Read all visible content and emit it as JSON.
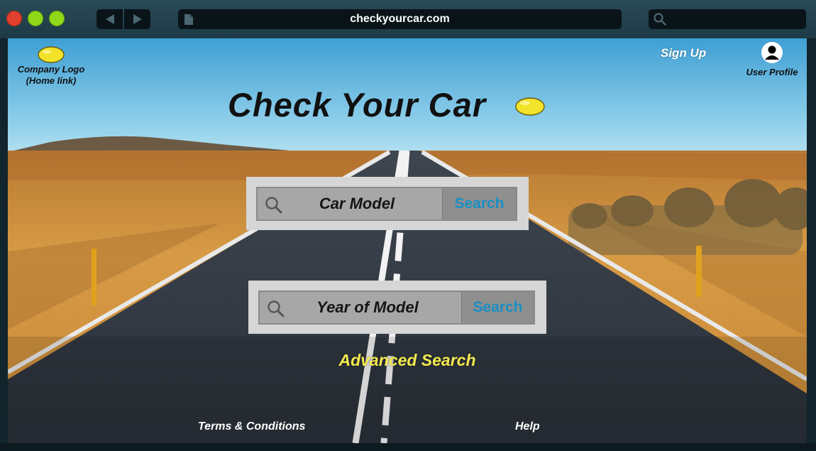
{
  "browser": {
    "url": "checkyourcar.com",
    "window_controls": [
      "close",
      "minimize",
      "maximize"
    ],
    "icons": {
      "back": "back-arrow-icon",
      "forward": "forward-arrow-icon",
      "page": "document-icon",
      "search": "search-icon"
    }
  },
  "header": {
    "logo_label": "Company Logo\n(Home link)",
    "logo_icon": "lemon-icon",
    "sign_up": "Sign Up",
    "user_profile": "User Profile",
    "user_icon": "user-avatar-icon"
  },
  "main": {
    "title": "Check Your Car",
    "search_model": {
      "label": "Car Model",
      "button": "Search"
    },
    "search_year": {
      "label": "Year of Model",
      "button": "Search"
    },
    "advanced_search": "Advanced Search"
  },
  "footer": {
    "terms": "Terms & Conditions",
    "help": "Help"
  },
  "colors": {
    "accent_search": "#1a8fc4",
    "advanced_link": "#f5ea4f",
    "lemon": "#f2e22a"
  }
}
